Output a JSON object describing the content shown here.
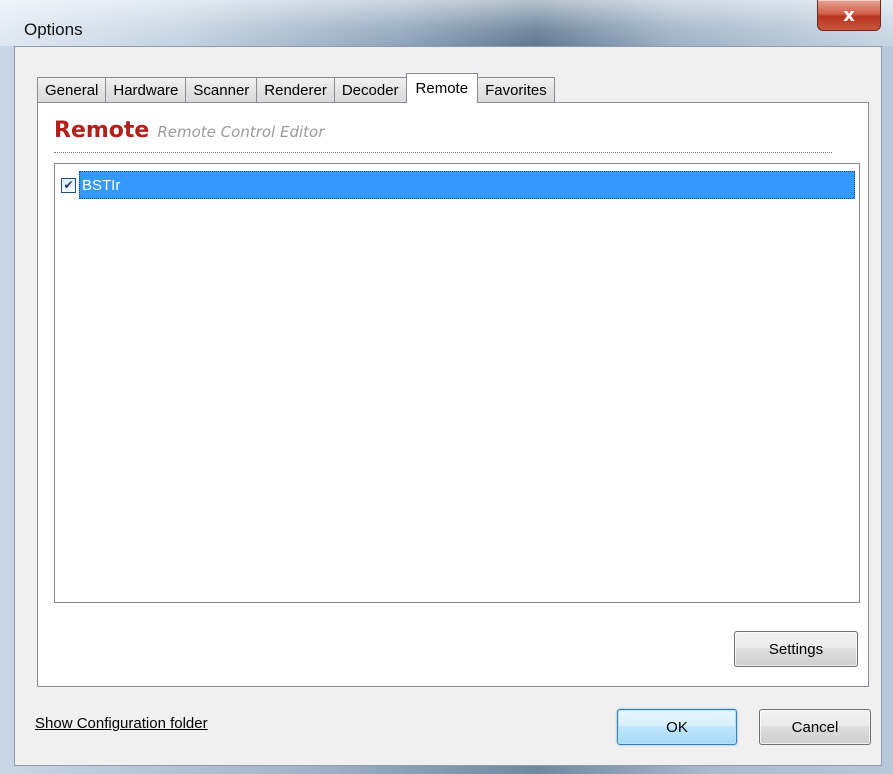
{
  "window": {
    "title": "Options",
    "close_glyph": "x"
  },
  "tabs": [
    {
      "label": "General"
    },
    {
      "label": "Hardware"
    },
    {
      "label": "Scanner"
    },
    {
      "label": "Renderer"
    },
    {
      "label": "Decoder"
    },
    {
      "label": "Remote",
      "active": true
    },
    {
      "label": "Favorites"
    }
  ],
  "section": {
    "title": "Remote",
    "subtitle": "Remote Control Editor"
  },
  "list": {
    "items": [
      {
        "label": "BSTIr",
        "checked": true,
        "selected": true
      }
    ]
  },
  "buttons": {
    "settings": "Settings",
    "ok": "OK",
    "cancel": "Cancel"
  },
  "footer": {
    "config_link": "Show Configuration folder"
  },
  "colors": {
    "section_title": "#b3201a",
    "selection": "#3399ff"
  }
}
